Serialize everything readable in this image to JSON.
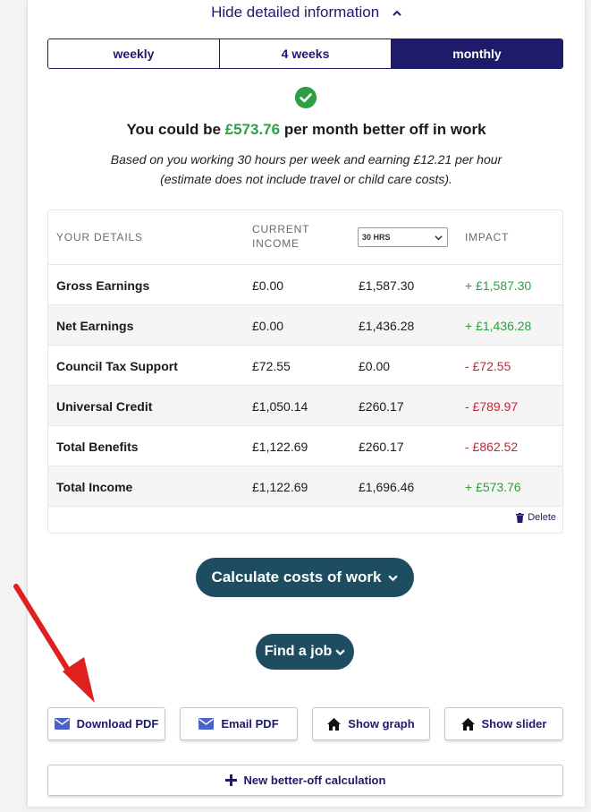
{
  "toggle": {
    "label": "Hide detailed information"
  },
  "periods": [
    {
      "label": "weekly",
      "active": false
    },
    {
      "label": "4 weeks",
      "active": false
    },
    {
      "label": "monthly",
      "active": true
    }
  ],
  "result": {
    "prefix": "You could be ",
    "amount": "£573.76",
    "suffix": " per month better off in work",
    "sub_line1": "Based on you working 30 hours per week and earning £12.21 per hour",
    "sub_line2": "(estimate does not include travel or child care costs)."
  },
  "table": {
    "headers": {
      "details": "YOUR DETAILS",
      "current_line1": "CURRENT",
      "current_line2": "INCOME",
      "impact": "IMPACT"
    },
    "hours_select": "30 HRS",
    "rows": [
      {
        "label": "Gross Earnings",
        "current": "£0.00",
        "new": "£1,587.30",
        "impact": "+ £1,587.30",
        "trend": "pos"
      },
      {
        "label": "Net Earnings",
        "current": "£0.00",
        "new": "£1,436.28",
        "impact": "+ £1,436.28",
        "trend": "pos"
      },
      {
        "label": "Council Tax Support",
        "current": "£72.55",
        "new": "£0.00",
        "impact": "- £72.55",
        "trend": "neg"
      },
      {
        "label": "Universal Credit",
        "current": "£1,050.14",
        "new": "£260.17",
        "impact": "- £789.97",
        "trend": "neg"
      },
      {
        "label": "Total Benefits",
        "current": "£1,122.69",
        "new": "£260.17",
        "impact": "- £862.52",
        "trend": "neg"
      },
      {
        "label": "Total Income",
        "current": "£1,122.69",
        "new": "£1,696.46",
        "impact": "+ £573.76",
        "trend": "pos"
      }
    ],
    "delete_label": "Delete"
  },
  "buttons": {
    "calculate_costs": "Calculate costs of work",
    "find_job": "Find a job",
    "download_pdf": "Download PDF",
    "email_pdf": "Email PDF",
    "show_graph": "Show graph",
    "show_slider": "Show slider",
    "new_calculation": "New better-off calculation"
  },
  "colors": {
    "brand": "#1e1b6b",
    "positive": "#2e9e44",
    "negative": "#c0283a",
    "pill": "#1e4d61",
    "annotation_arrow": "#e02020"
  },
  "icons": {
    "toggle": "chevron-up-icon",
    "success": "check-circle-icon",
    "select": "chevron-down-icon",
    "delete": "trash-icon",
    "download": "envelope-icon",
    "email": "envelope-icon",
    "graph": "home-icon",
    "slider": "home-icon",
    "new": "plus-icon"
  }
}
